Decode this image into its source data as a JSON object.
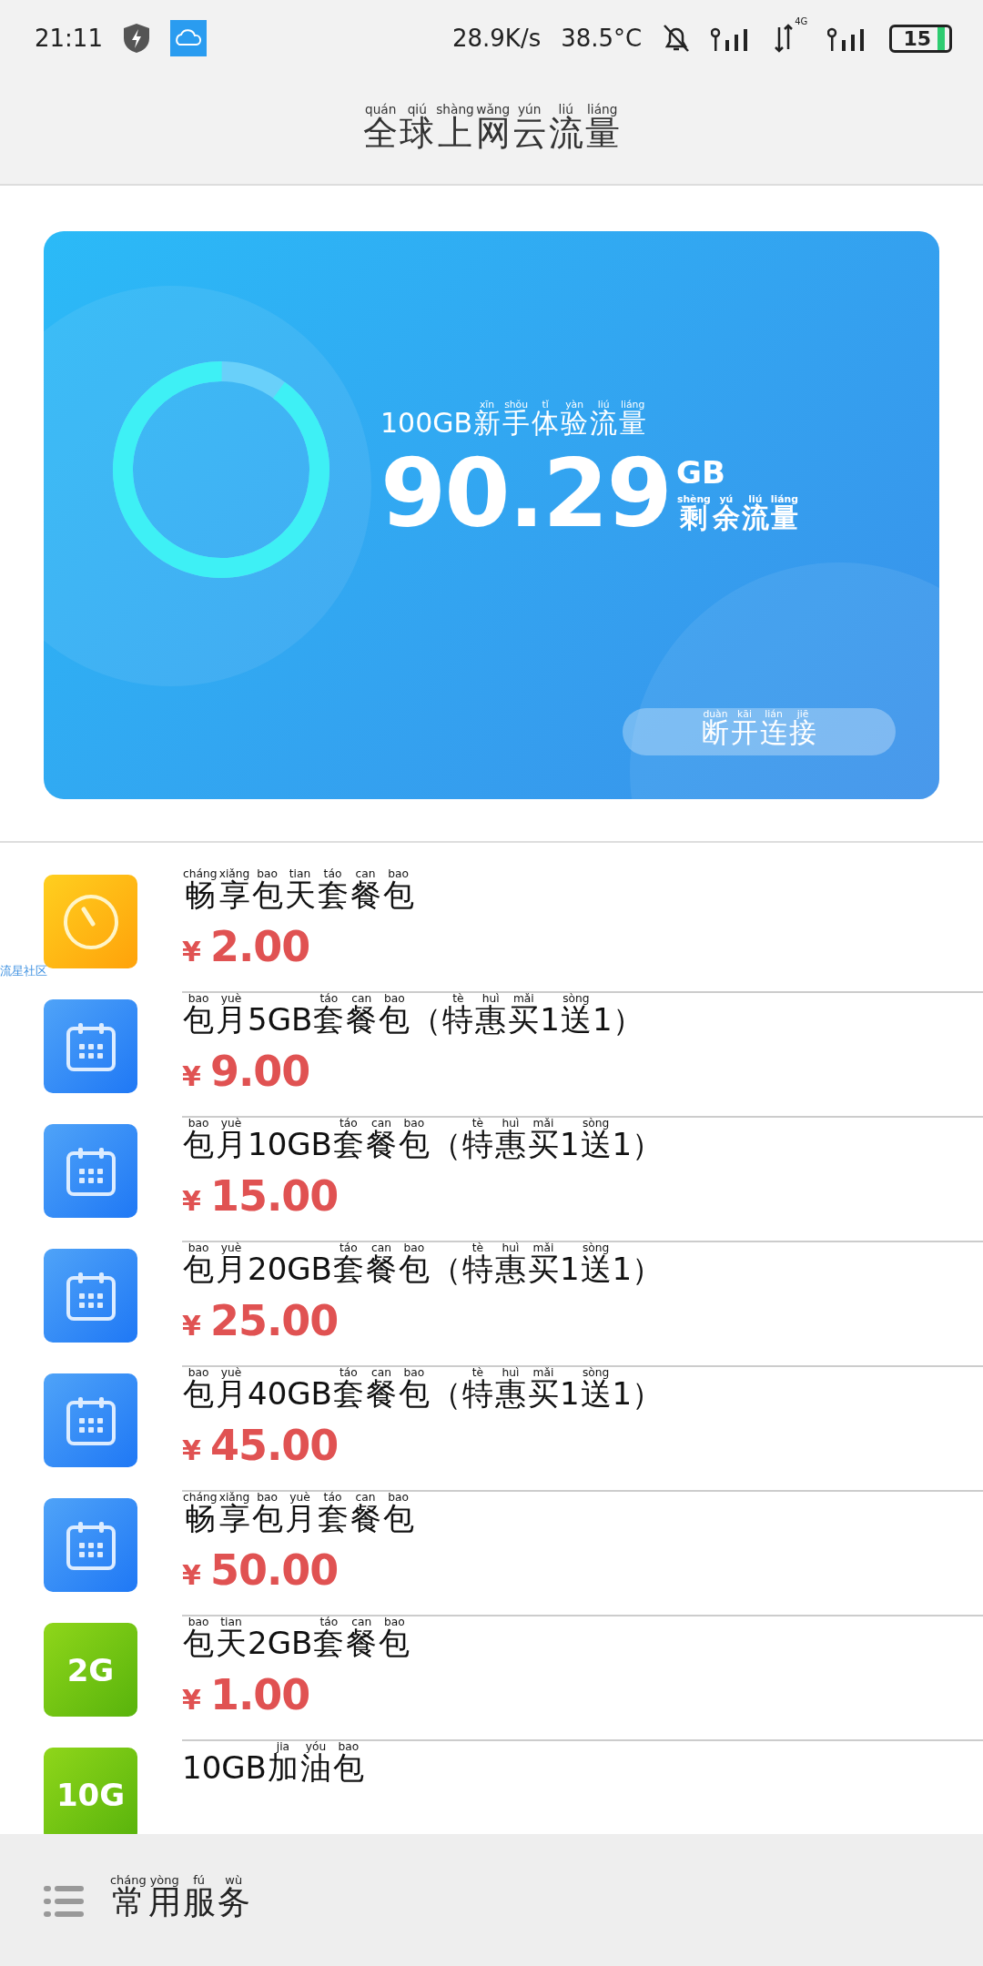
{
  "status_bar": {
    "time": "21:11",
    "speed": "28.9K/s",
    "temperature": "38.5°C",
    "network": "4G",
    "battery": "15"
  },
  "header": {
    "title": [
      [
        "quán",
        "全"
      ],
      [
        "qiú",
        "球"
      ],
      [
        "shàng",
        "上"
      ],
      [
        "wǎng",
        "网"
      ],
      [
        "yún",
        "云"
      ],
      [
        "liú",
        "流"
      ],
      [
        "liáng",
        "量"
      ]
    ]
  },
  "card": {
    "plan": [
      [
        "100GB"
      ],
      [
        "xīn",
        "新"
      ],
      [
        "shǒu",
        "手"
      ],
      [
        "tǐ",
        "体"
      ],
      [
        "yàn",
        "验"
      ],
      [
        "liú",
        "流"
      ],
      [
        "liáng",
        "量"
      ]
    ],
    "remaining": "90.29",
    "unit": "GB",
    "remaining_label": [
      [
        "shèng",
        "剩"
      ],
      [
        "yú",
        "余"
      ],
      [
        "liú",
        "流"
      ],
      [
        "liáng",
        "量"
      ]
    ],
    "button": [
      [
        "duàn",
        "断"
      ],
      [
        "kāi",
        "开"
      ],
      [
        "lián",
        "连"
      ],
      [
        "jiē",
        "接"
      ]
    ]
  },
  "overlay_label": "流星社区",
  "packages": [
    {
      "icon": {
        "kind": "clock"
      },
      "name": [
        [
          "cháng",
          "畅"
        ],
        [
          "xiǎng",
          "享"
        ],
        [
          "bao",
          "包"
        ],
        [
          "tian",
          "天"
        ],
        [
          "táo",
          "套"
        ],
        [
          "can",
          "餐"
        ],
        [
          "bao",
          "包"
        ]
      ],
      "currency": "¥",
      "price": "2.00"
    },
    {
      "icon": {
        "kind": "calendar"
      },
      "name": [
        [
          "bao",
          "包"
        ],
        [
          "yuè",
          "月"
        ],
        [
          "5GB"
        ],
        [
          "táo",
          "套"
        ],
        [
          "can",
          "餐"
        ],
        [
          "bao",
          "包"
        ],
        [
          "（"
        ],
        [
          "tè",
          "特"
        ],
        [
          "huì",
          "惠"
        ],
        [
          "mǎi",
          "买"
        ],
        [
          "1"
        ],
        [
          "sòng",
          "送"
        ],
        [
          "1）"
        ]
      ],
      "currency": "¥",
      "price": "9.00"
    },
    {
      "icon": {
        "kind": "calendar"
      },
      "name": [
        [
          "bao",
          "包"
        ],
        [
          "yuè",
          "月"
        ],
        [
          "10GB"
        ],
        [
          "táo",
          "套"
        ],
        [
          "can",
          "餐"
        ],
        [
          "bao",
          "包"
        ],
        [
          "（"
        ],
        [
          "tè",
          "特"
        ],
        [
          "huì",
          "惠"
        ],
        [
          "mǎi",
          "买"
        ],
        [
          "1"
        ],
        [
          "sòng",
          "送"
        ],
        [
          "1）"
        ]
      ],
      "currency": "¥",
      "price": "15.00"
    },
    {
      "icon": {
        "kind": "calendar"
      },
      "name": [
        [
          "bao",
          "包"
        ],
        [
          "yuè",
          "月"
        ],
        [
          "20GB"
        ],
        [
          "táo",
          "套"
        ],
        [
          "can",
          "餐"
        ],
        [
          "bao",
          "包"
        ],
        [
          "（"
        ],
        [
          "tè",
          "特"
        ],
        [
          "huì",
          "惠"
        ],
        [
          "mǎi",
          "买"
        ],
        [
          "1"
        ],
        [
          "sòng",
          "送"
        ],
        [
          "1）"
        ]
      ],
      "currency": "¥",
      "price": "25.00"
    },
    {
      "icon": {
        "kind": "calendar"
      },
      "name": [
        [
          "bao",
          "包"
        ],
        [
          "yuè",
          "月"
        ],
        [
          "40GB"
        ],
        [
          "táo",
          "套"
        ],
        [
          "can",
          "餐"
        ],
        [
          "bao",
          "包"
        ],
        [
          "（"
        ],
        [
          "tè",
          "特"
        ],
        [
          "huì",
          "惠"
        ],
        [
          "mǎi",
          "买"
        ],
        [
          "1"
        ],
        [
          "sòng",
          "送"
        ],
        [
          "1）"
        ]
      ],
      "currency": "¥",
      "price": "45.00"
    },
    {
      "icon": {
        "kind": "calendar"
      },
      "name": [
        [
          "cháng",
          "畅"
        ],
        [
          "xiǎng",
          "享"
        ],
        [
          "bao",
          "包"
        ],
        [
          "yuè",
          "月"
        ],
        [
          "táo",
          "套"
        ],
        [
          "can",
          "餐"
        ],
        [
          "bao",
          "包"
        ]
      ],
      "currency": "¥",
      "price": "50.00"
    },
    {
      "icon": {
        "kind": "badge",
        "text": "2G"
      },
      "name": [
        [
          "bao",
          "包"
        ],
        [
          "tian",
          "天"
        ],
        [
          "2GB"
        ],
        [
          "táo",
          "套"
        ],
        [
          "can",
          "餐"
        ],
        [
          "bao",
          "包"
        ]
      ],
      "currency": "¥",
      "price": "1.00"
    },
    {
      "icon": {
        "kind": "badge",
        "text": "10G"
      },
      "name": [
        [
          "10GB"
        ],
        [
          "jia",
          "加"
        ],
        [
          "yóu",
          "油"
        ],
        [
          "bao",
          "包"
        ]
      ]
    }
  ],
  "bottom_bar": {
    "label": [
      [
        "cháng",
        "常"
      ],
      [
        "yòng",
        "用"
      ],
      [
        "fú",
        "服"
      ],
      [
        "wù",
        "务"
      ]
    ]
  }
}
